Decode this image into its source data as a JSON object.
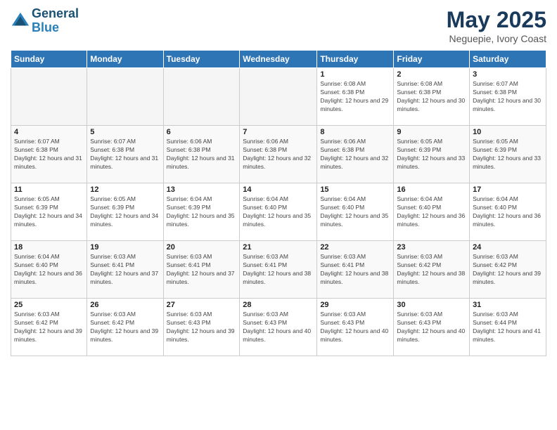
{
  "header": {
    "logo_line1": "General",
    "logo_line2": "Blue",
    "main_title": "May 2025",
    "subtitle": "Neguepie, Ivory Coast"
  },
  "weekdays": [
    "Sunday",
    "Monday",
    "Tuesday",
    "Wednesday",
    "Thursday",
    "Friday",
    "Saturday"
  ],
  "weeks": [
    [
      {
        "day": "",
        "info": ""
      },
      {
        "day": "",
        "info": ""
      },
      {
        "day": "",
        "info": ""
      },
      {
        "day": "",
        "info": ""
      },
      {
        "day": "1",
        "info": "Sunrise: 6:08 AM\nSunset: 6:38 PM\nDaylight: 12 hours and 29 minutes."
      },
      {
        "day": "2",
        "info": "Sunrise: 6:08 AM\nSunset: 6:38 PM\nDaylight: 12 hours and 30 minutes."
      },
      {
        "day": "3",
        "info": "Sunrise: 6:07 AM\nSunset: 6:38 PM\nDaylight: 12 hours and 30 minutes."
      }
    ],
    [
      {
        "day": "4",
        "info": "Sunrise: 6:07 AM\nSunset: 6:38 PM\nDaylight: 12 hours and 31 minutes."
      },
      {
        "day": "5",
        "info": "Sunrise: 6:07 AM\nSunset: 6:38 PM\nDaylight: 12 hours and 31 minutes."
      },
      {
        "day": "6",
        "info": "Sunrise: 6:06 AM\nSunset: 6:38 PM\nDaylight: 12 hours and 31 minutes."
      },
      {
        "day": "7",
        "info": "Sunrise: 6:06 AM\nSunset: 6:38 PM\nDaylight: 12 hours and 32 minutes."
      },
      {
        "day": "8",
        "info": "Sunrise: 6:06 AM\nSunset: 6:38 PM\nDaylight: 12 hours and 32 minutes."
      },
      {
        "day": "9",
        "info": "Sunrise: 6:05 AM\nSunset: 6:39 PM\nDaylight: 12 hours and 33 minutes."
      },
      {
        "day": "10",
        "info": "Sunrise: 6:05 AM\nSunset: 6:39 PM\nDaylight: 12 hours and 33 minutes."
      }
    ],
    [
      {
        "day": "11",
        "info": "Sunrise: 6:05 AM\nSunset: 6:39 PM\nDaylight: 12 hours and 34 minutes."
      },
      {
        "day": "12",
        "info": "Sunrise: 6:05 AM\nSunset: 6:39 PM\nDaylight: 12 hours and 34 minutes."
      },
      {
        "day": "13",
        "info": "Sunrise: 6:04 AM\nSunset: 6:39 PM\nDaylight: 12 hours and 35 minutes."
      },
      {
        "day": "14",
        "info": "Sunrise: 6:04 AM\nSunset: 6:40 PM\nDaylight: 12 hours and 35 minutes."
      },
      {
        "day": "15",
        "info": "Sunrise: 6:04 AM\nSunset: 6:40 PM\nDaylight: 12 hours and 35 minutes."
      },
      {
        "day": "16",
        "info": "Sunrise: 6:04 AM\nSunset: 6:40 PM\nDaylight: 12 hours and 36 minutes."
      },
      {
        "day": "17",
        "info": "Sunrise: 6:04 AM\nSunset: 6:40 PM\nDaylight: 12 hours and 36 minutes."
      }
    ],
    [
      {
        "day": "18",
        "info": "Sunrise: 6:04 AM\nSunset: 6:40 PM\nDaylight: 12 hours and 36 minutes."
      },
      {
        "day": "19",
        "info": "Sunrise: 6:03 AM\nSunset: 6:41 PM\nDaylight: 12 hours and 37 minutes."
      },
      {
        "day": "20",
        "info": "Sunrise: 6:03 AM\nSunset: 6:41 PM\nDaylight: 12 hours and 37 minutes."
      },
      {
        "day": "21",
        "info": "Sunrise: 6:03 AM\nSunset: 6:41 PM\nDaylight: 12 hours and 38 minutes."
      },
      {
        "day": "22",
        "info": "Sunrise: 6:03 AM\nSunset: 6:41 PM\nDaylight: 12 hours and 38 minutes."
      },
      {
        "day": "23",
        "info": "Sunrise: 6:03 AM\nSunset: 6:42 PM\nDaylight: 12 hours and 38 minutes."
      },
      {
        "day": "24",
        "info": "Sunrise: 6:03 AM\nSunset: 6:42 PM\nDaylight: 12 hours and 39 minutes."
      }
    ],
    [
      {
        "day": "25",
        "info": "Sunrise: 6:03 AM\nSunset: 6:42 PM\nDaylight: 12 hours and 39 minutes."
      },
      {
        "day": "26",
        "info": "Sunrise: 6:03 AM\nSunset: 6:42 PM\nDaylight: 12 hours and 39 minutes."
      },
      {
        "day": "27",
        "info": "Sunrise: 6:03 AM\nSunset: 6:43 PM\nDaylight: 12 hours and 39 minutes."
      },
      {
        "day": "28",
        "info": "Sunrise: 6:03 AM\nSunset: 6:43 PM\nDaylight: 12 hours and 40 minutes."
      },
      {
        "day": "29",
        "info": "Sunrise: 6:03 AM\nSunset: 6:43 PM\nDaylight: 12 hours and 40 minutes."
      },
      {
        "day": "30",
        "info": "Sunrise: 6:03 AM\nSunset: 6:43 PM\nDaylight: 12 hours and 40 minutes."
      },
      {
        "day": "31",
        "info": "Sunrise: 6:03 AM\nSunset: 6:44 PM\nDaylight: 12 hours and 41 minutes."
      }
    ]
  ],
  "colors": {
    "header_bg": "#2e75b6",
    "header_text": "#ffffff",
    "title_color": "#1a3a5c",
    "logo_color": "#1a5276"
  }
}
